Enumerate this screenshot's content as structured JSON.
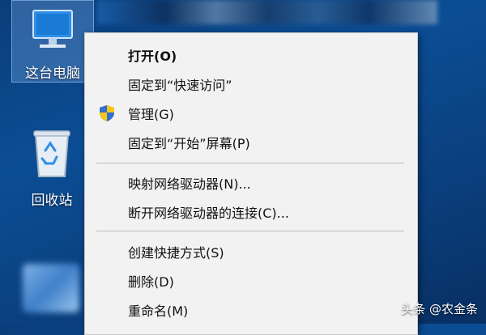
{
  "desktop": {
    "icons": [
      {
        "label": "这台电脑",
        "icon": "computer-icon"
      },
      {
        "label": "回收站",
        "icon": "recycle-bin-icon"
      }
    ]
  },
  "context_menu": {
    "items": [
      {
        "label": "打开(O)",
        "bold": true
      },
      {
        "label": "固定到“快速访问”"
      },
      {
        "label": "管理(G)",
        "icon": "shield-icon"
      },
      {
        "label": "固定到“开始”屏幕(P)"
      },
      {
        "label": "映射网络驱动器(N)..."
      },
      {
        "label": "断开网络驱动器的连接(C)..."
      },
      {
        "label": "创建快捷方式(S)"
      },
      {
        "label": "删除(D)"
      },
      {
        "label": "重命名(M)"
      }
    ]
  },
  "watermark": "头条 @农金条",
  "colors": {
    "desktop_bg": "#0b4d94",
    "menu_bg": "#f2f2f2",
    "selection": "#78aae6"
  }
}
